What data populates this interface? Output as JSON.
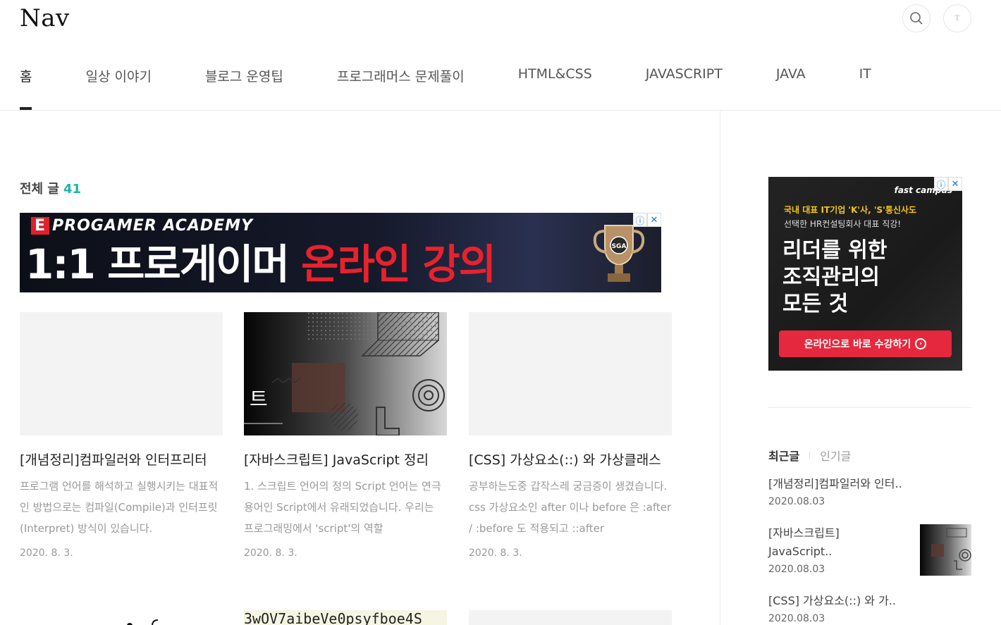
{
  "blog": {
    "title": "Nav",
    "profile_initial": "T"
  },
  "nav": {
    "items": [
      "홈",
      "일상 이야기",
      "블로그 운영팁",
      "프로그래머스 문제풀이",
      "HTML&CSS",
      "JAVASCRIPT",
      "JAVA",
      "IT"
    ]
  },
  "main": {
    "total_label": "전체 글",
    "total_count": "41",
    "posts": [
      {
        "title": "[개념정리]컴파일러와 인터프리터",
        "summary": "프로그램 언어를 해석하고 실행시키는 대표적인 방법으로는 컴파일(Compile)과 인터프릿(Interpret) 방식이 있습니다.",
        "date": "2020. 8. 3."
      },
      {
        "title": "[자바스크립트] JavaScript 정리",
        "summary": "1. 스크립트 언어의 정의 Script 언어는 연극 용어인 Script에서 유래되었습니다. 우리는 프로그래밍에서 'script'의 역할",
        "date": "2020. 8. 3."
      },
      {
        "title": "[CSS] 가상요소(::) 와 가상클래스",
        "summary": "공부하는도중 갑작스레 궁금증이 생겼습니다. css 가상요소인 after 이나 before 은 :after / :before 도 적용되고 ::after",
        "date": "2020. 8. 3."
      }
    ],
    "thumb_text": "트",
    "row2_snippet": "3wOV7aibeVe0psyfboe4S"
  },
  "ad_banner": {
    "brand": "PROGAMER ACADEMY",
    "headline_white": "1:1 프로게이머 ",
    "headline_red": "온라인 강의",
    "trophy_text": "SGA"
  },
  "side_ad": {
    "brand": "fast campus",
    "line1": "국내 대표 IT기업 'K'사, 'S'통신사도",
    "line2": "선택한 HR컨설팅회사 대표 직강!",
    "big": "리더를 위한\n조직관리의\n모든 것",
    "cta": "온라인으로 바로 수강하기"
  },
  "sidebar": {
    "tabs": [
      "최근글",
      "인기글"
    ],
    "recent": [
      {
        "title": "[개념정리]컴파일러와 인터..",
        "date": "2020.08.03"
      },
      {
        "title": "[자바스크립트] JavaScript..",
        "date": "2020.08.03"
      },
      {
        "title": "[CSS] 가상요소(::) 와 가..",
        "date": "2020.08.03"
      }
    ]
  },
  "colors": {
    "accent": "#1db5a9",
    "text": "#222222",
    "muted": "#999999",
    "ad_red": "#e5283d"
  }
}
